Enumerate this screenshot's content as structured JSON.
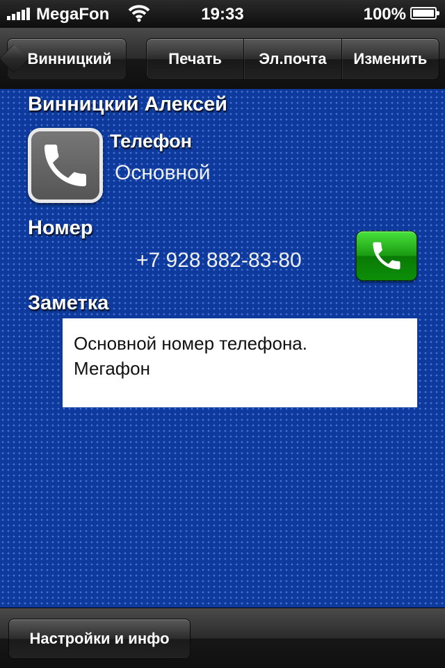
{
  "status_bar": {
    "carrier": "MegaFon",
    "time": "19:33",
    "battery_percent": "100%",
    "signal_icon": "signal-bars-icon",
    "wifi_icon": "wifi-icon",
    "battery_icon": "battery-charging-icon"
  },
  "nav": {
    "back_label": "Винницкий",
    "actions": [
      "Печать",
      "Эл.почта",
      "Изменить"
    ]
  },
  "contact": {
    "name": "Винницкий Алексей",
    "phone_label": "Телефон",
    "phone_type": "Основной",
    "phone_icon": "phone-handset-icon",
    "number_label": "Номер",
    "number": "+7 928 882-83-80",
    "call_icon": "call-icon",
    "note_label": "Заметка",
    "note_lines": [
      "Основной номер телефона.",
      "Мегафон"
    ]
  },
  "toolbar": {
    "settings_label": "Настройки и инфо"
  },
  "colors": {
    "background": "#0d3a9c",
    "call_button": "#1a9a12"
  }
}
